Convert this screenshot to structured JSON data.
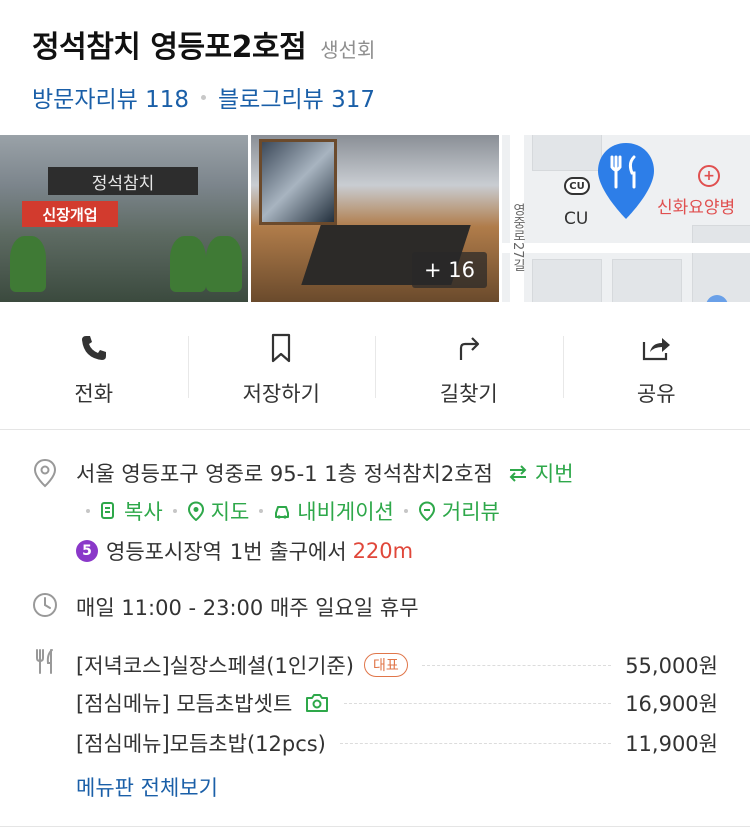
{
  "header": {
    "title": "정석참치 영등포2호점",
    "category": "생선회",
    "visitor_review_label": "방문자리뷰 118",
    "blog_review_label": "블로그리뷰 317"
  },
  "photos": {
    "store_sign_top": "정석참치",
    "store_sign_banner": "신장개업",
    "more_count_label": "+ 16",
    "map": {
      "cu_badge": "CU",
      "cu_label": "CU",
      "hospital_label": "신화요양병",
      "road_label": "영중로27길"
    }
  },
  "actions": [
    {
      "label": "전화",
      "icon": "phone-icon"
    },
    {
      "label": "저장하기",
      "icon": "bookmark-icon"
    },
    {
      "label": "길찾기",
      "icon": "directions-icon"
    },
    {
      "label": "공유",
      "icon": "share-icon"
    }
  ],
  "address": {
    "text": "서울 영등포구 영중로 95-1 1층 정석참치2호점",
    "swap_label": "지번",
    "links": [
      {
        "label": "복사",
        "icon": "copy-icon"
      },
      {
        "label": "지도",
        "icon": "map-pin-icon"
      },
      {
        "label": "내비게이션",
        "icon": "car-icon"
      },
      {
        "label": "거리뷰",
        "icon": "street-view-icon"
      }
    ],
    "subway": {
      "line_number": "5",
      "station": "영등포시장역",
      "exit_text": "1번 출구에서",
      "distance": "220m",
      "line_color": "#8a38c9"
    }
  },
  "hours": {
    "text": "매일 11:00 - 23:00 매주 일요일 휴무"
  },
  "menu": {
    "items": [
      {
        "name": "[저녁코스]실장스페셜(1인기준)",
        "price": "55,000원",
        "badge": "대표"
      },
      {
        "name": "[점심메뉴] 모듬초밥셋트",
        "price": "16,900원"
      },
      {
        "name": "[점심메뉴]모듬초밥(12pcs)",
        "price": "11,900원"
      }
    ],
    "more_label": "메뉴판 전체보기"
  },
  "colors": {
    "link_blue": "#1a5fa8",
    "green": "#2ea84a",
    "distance_red": "#e0473a",
    "badge_orange": "#e0764a"
  }
}
